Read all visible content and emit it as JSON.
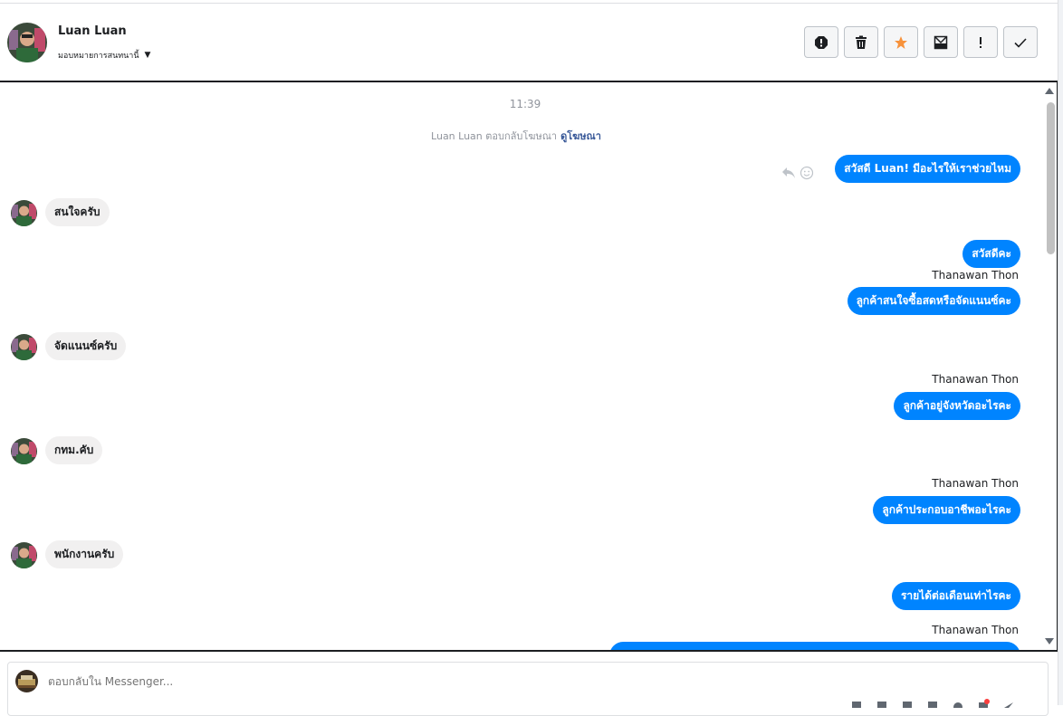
{
  "header": {
    "name": "Luan Luan",
    "assign_label": "มอบหมายการสนทนานี้"
  },
  "toolbar": {
    "buttons": [
      {
        "name": "alert-icon"
      },
      {
        "name": "trash-icon"
      },
      {
        "name": "star-icon",
        "color": "#f7923b"
      },
      {
        "name": "mark-unread-icon"
      },
      {
        "name": "exclamation-icon"
      },
      {
        "name": "check-icon"
      }
    ]
  },
  "chat": {
    "timestamp": "11:39",
    "ad_reply": "Luan Luan ตอบกลับโฆษณา",
    "ad_link": "ดูโฆษณา",
    "messages": [
      {
        "dir": "out",
        "text": "สวัสดี Luan! มีอะไรให้เราช่วยไหม"
      },
      {
        "dir": "in",
        "text": "สนใจครับ"
      },
      {
        "dir": "out",
        "text": "สวัสดีคะ"
      },
      {
        "dir": "out",
        "sender": "Thanawan Thon",
        "text": "ลูกค้าสนใจซื้อสดหรือจัดแนนซ์คะ"
      },
      {
        "dir": "in",
        "text": "จัดแนนซ์ครับ"
      },
      {
        "dir": "out",
        "sender": "Thanawan Thon",
        "text": "ลูกค้าอยู่จังหวัดอะไรคะ"
      },
      {
        "dir": "in",
        "text": "กทม.คับ"
      },
      {
        "dir": "out",
        "sender": "Thanawan Thon",
        "text": "ลูกค้าประกอบอาชีพอะไรคะ"
      },
      {
        "dir": "in",
        "text": "พนักงานครับ"
      },
      {
        "dir": "out",
        "text": "รายได้ต่อเดือนเท่าไรคะ"
      },
      {
        "dir": "out",
        "sender": "Thanawan Thon",
        "text": ""
      }
    ]
  },
  "composer": {
    "placeholder": "ตอบกลับใน Messenger..."
  },
  "colors": {
    "outgoing_bubble": "#0084ff",
    "incoming_bubble": "#f1f0f0",
    "link": "#385898"
  }
}
